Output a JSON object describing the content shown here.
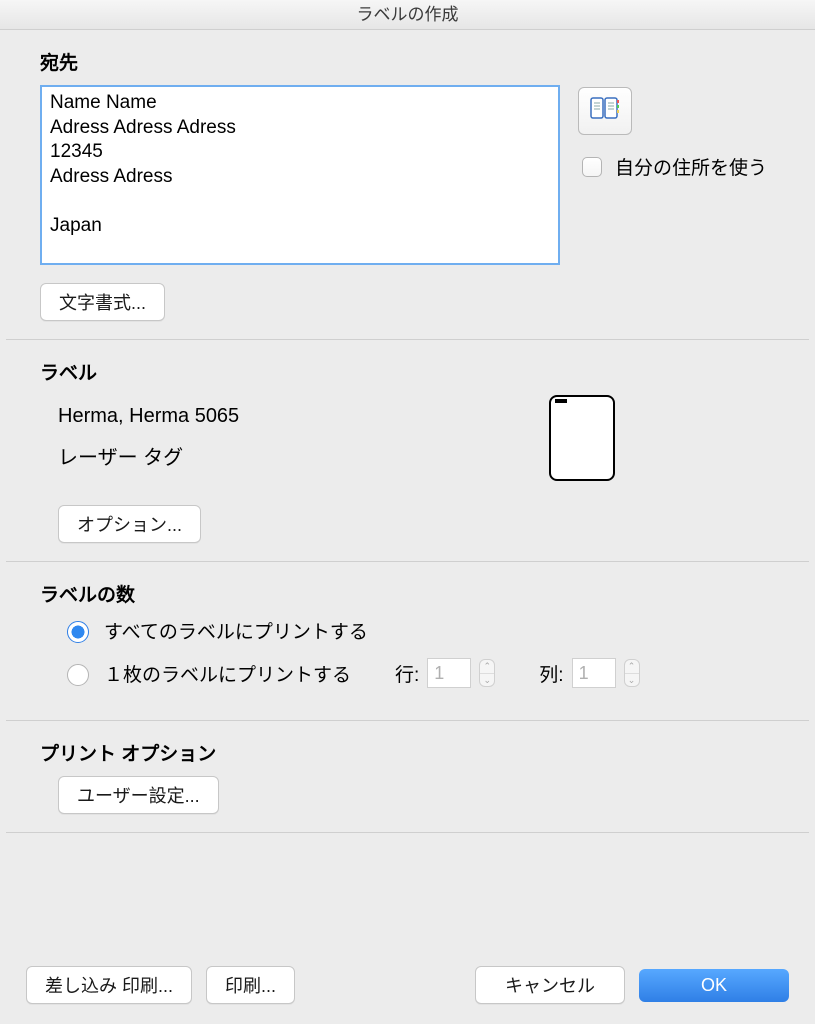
{
  "title": "ラベルの作成",
  "address_section": {
    "heading": "宛先",
    "textarea_value": "Name Name\nAdress Adress Adress\n12345\nAdress Adress\n\nJapan",
    "use_own_address_label": "自分の住所を使う",
    "format_button": "文字書式..."
  },
  "label_section": {
    "heading": "ラベル",
    "product": "Herma, Herma 5065",
    "description": "レーザー タグ",
    "options_button": "オプション..."
  },
  "count_section": {
    "heading": "ラベルの数",
    "radio_all": "すべてのラベルにプリントする",
    "radio_one": "１枚のラベルにプリントする",
    "row_label": "行:",
    "row_value": "1",
    "col_label": "列:",
    "col_value": "1"
  },
  "print_options_section": {
    "heading": "プリント オプション",
    "user_settings_button": "ユーザー設定..."
  },
  "footer": {
    "mail_merge": "差し込み 印刷...",
    "print": "印刷...",
    "cancel": "キャンセル",
    "ok": "OK"
  }
}
